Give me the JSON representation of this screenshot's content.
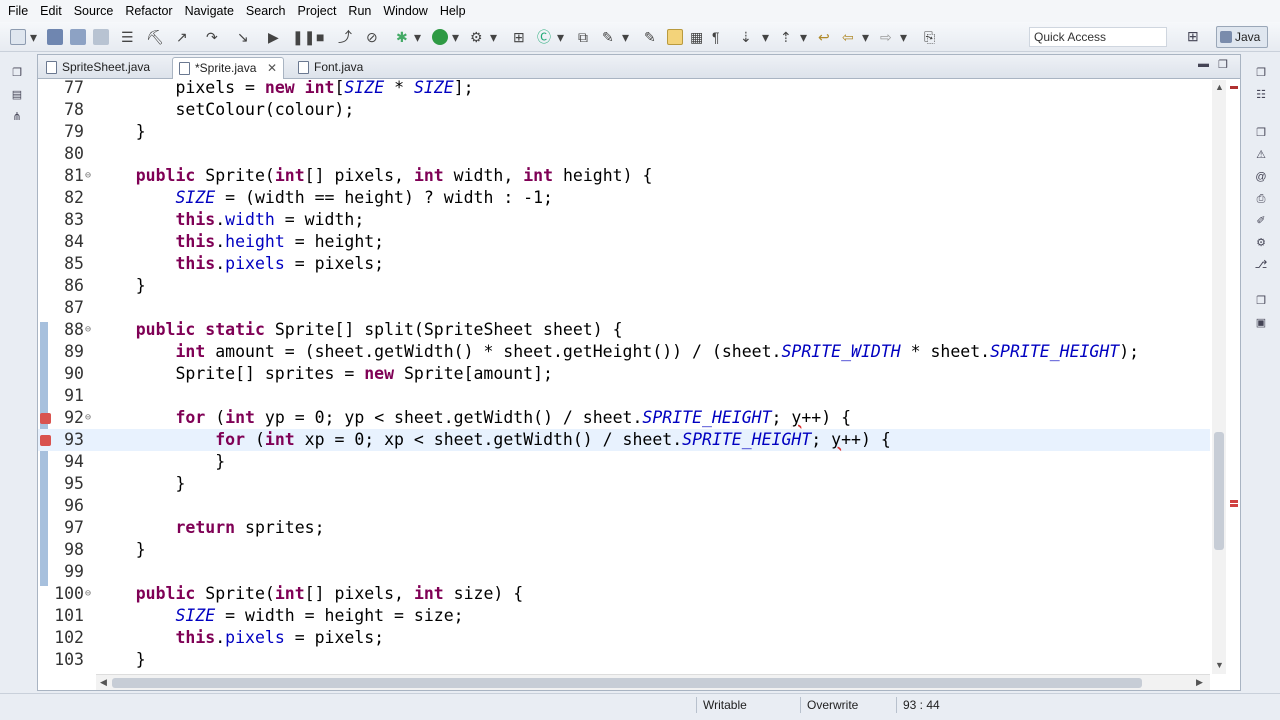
{
  "menu": [
    "File",
    "Edit",
    "Source",
    "Refactor",
    "Navigate",
    "Search",
    "Project",
    "Run",
    "Window",
    "Help"
  ],
  "toolbar": {
    "quick_access_placeholder": "Quick Access",
    "perspective_label": "Java"
  },
  "tabs": [
    {
      "label": "SpriteSheet.java",
      "active": false
    },
    {
      "label": "*Sprite.java",
      "active": true,
      "close": "✕"
    },
    {
      "label": "Font.java",
      "active": false
    }
  ],
  "editor": {
    "current_line": "93",
    "lines": [
      {
        "n": "77",
        "text": "        pixels = new int[SIZE * SIZE];"
      },
      {
        "n": "78",
        "text": "        setColour(colour);"
      },
      {
        "n": "79",
        "text": "    }"
      },
      {
        "n": "80",
        "text": ""
      },
      {
        "n": "81",
        "text": "    public Sprite(int[] pixels, int width, int height) {"
      },
      {
        "n": "82",
        "text": "        SIZE = (width == height) ? width : -1;"
      },
      {
        "n": "83",
        "text": "        this.width = width;"
      },
      {
        "n": "84",
        "text": "        this.height = height;"
      },
      {
        "n": "85",
        "text": "        this.pixels = pixels;"
      },
      {
        "n": "86",
        "text": "    }"
      },
      {
        "n": "87",
        "text": ""
      },
      {
        "n": "88",
        "text": "    public static Sprite[] split(SpriteSheet sheet) {"
      },
      {
        "n": "89",
        "text": "        int amount = (sheet.getWidth() * sheet.getHeight()) / (sheet.SPRITE_WIDTH * sheet.SPRITE_HEIGHT);"
      },
      {
        "n": "90",
        "text": "        Sprite[] sprites = new Sprite[amount];"
      },
      {
        "n": "91",
        "text": ""
      },
      {
        "n": "92",
        "text": "        for (int yp = 0; yp < sheet.getWidth() / sheet.SPRITE_HEIGHT; y++) {"
      },
      {
        "n": "93",
        "text": "            for (int xp = 0; xp < sheet.getWidth() / sheet.SPRITE_HEIGHT; y++) {"
      },
      {
        "n": "94",
        "text": "            }"
      },
      {
        "n": "95",
        "text": "        }"
      },
      {
        "n": "96",
        "text": ""
      },
      {
        "n": "97",
        "text": "        return sprites;"
      },
      {
        "n": "98",
        "text": "    }"
      },
      {
        "n": "99",
        "text": ""
      },
      {
        "n": "100",
        "text": "    public Sprite(int[] pixels, int size) {"
      },
      {
        "n": "101",
        "text": "        SIZE = width = height = size;"
      },
      {
        "n": "102",
        "text": "        this.pixels = pixels;"
      },
      {
        "n": "103",
        "text": "    }"
      }
    ]
  },
  "status": {
    "writable": "Writable",
    "insert_mode": "Overwrite",
    "position": "93 : 44"
  },
  "colors": {
    "keyword": "#7f0055",
    "field": "#0000c0",
    "current_line_bg": "#e8f2fe",
    "error": "#d33333"
  }
}
